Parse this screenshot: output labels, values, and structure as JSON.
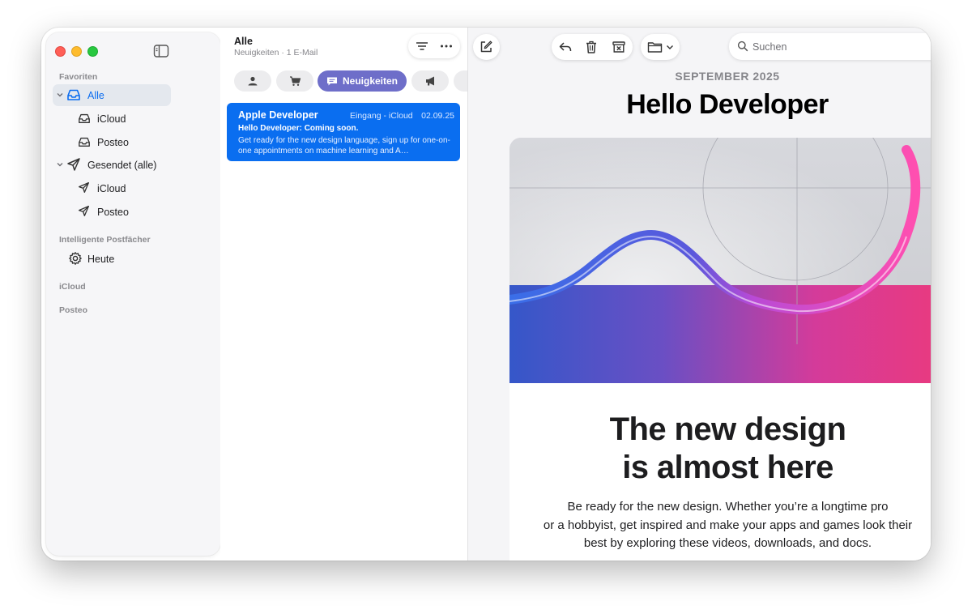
{
  "colors": {
    "accent": "#0a6ef0",
    "category_active": "#6e6ec9",
    "selected_sidebar": "#e4e8ee"
  },
  "sidebar": {
    "favorites_header": "Favoriten",
    "items": [
      {
        "label": "Alle",
        "icon": "tray-icon",
        "selected": true
      },
      {
        "label": "iCloud",
        "icon": "tray-icon"
      },
      {
        "label": "Posteo",
        "icon": "tray-icon"
      },
      {
        "label": "Gesendet (alle)",
        "icon": "paperplane-icon"
      },
      {
        "label": "iCloud",
        "icon": "paperplane-icon"
      },
      {
        "label": "Posteo",
        "icon": "paperplane-icon"
      }
    ],
    "smart_header": "Intelligente Postfächer",
    "smart_items": [
      {
        "label": "Heute",
        "icon": "gear-icon"
      }
    ],
    "accounts": [
      "iCloud",
      "Posteo"
    ]
  },
  "list": {
    "title": "Alle",
    "subtitle": "Neuigkeiten · 1 E-Mail",
    "categories": [
      {
        "icon": "person-icon"
      },
      {
        "icon": "cart-icon"
      },
      {
        "icon": "message-icon",
        "label": "Neuigkeiten",
        "active": true
      },
      {
        "icon": "megaphone-icon"
      }
    ],
    "messages": [
      {
        "from": "Apple Developer",
        "mailbox": "Eingang - iCloud",
        "date": "02.09.25",
        "subject": "Hello Developer: Coming soon.",
        "preview": "Get ready for the new design language, sign up for one-on-one appointments on machine learning and A…"
      }
    ]
  },
  "toolbar": {
    "search_placeholder": "Suchen"
  },
  "email": {
    "month": "SEPTEMBER 2025",
    "heading": "Hello Developer",
    "card_title_line1": "The new design",
    "card_title_line2": "is almost here",
    "body_line1": "Be ready for the new design. Whether you’re a longtime pro",
    "body_line2": "or a hobbyist, get inspired and make your apps and games look their",
    "body_line3": "best by exploring these videos, downloads, and docs."
  }
}
